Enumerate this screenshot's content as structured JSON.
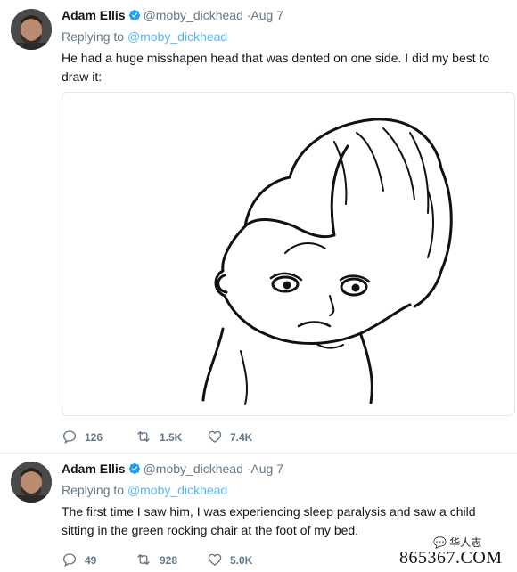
{
  "tweets": [
    {
      "author": {
        "name": "Adam Ellis",
        "handle": "@moby_dickhead",
        "time": "·Aug 7"
      },
      "reply": {
        "prefix": "Replying to",
        "mention": "@moby_dickhead"
      },
      "text": "He had a huge misshapen head that was dented on one side. I did my best to draw it:",
      "stats": {
        "replies": "126",
        "retweets": "1.5K",
        "likes": "7.4K"
      }
    },
    {
      "author": {
        "name": "Adam Ellis",
        "handle": "@moby_dickhead",
        "time": "·Aug 7"
      },
      "reply": {
        "prefix": "Replying to",
        "mention": "@moby_dickhead"
      },
      "text": "The first time I saw him, I was experiencing sleep paralysis and saw a child sitting in the green rocking chair at the foot of my bed.",
      "stats": {
        "replies": "49",
        "retweets": "928",
        "likes": "5.0K"
      }
    }
  ],
  "watermark": {
    "site": "865367.COM",
    "logo_text": "华人志"
  },
  "icons": {
    "reply": "reply-icon",
    "retweet": "retweet-icon",
    "like": "like-icon",
    "verified": "verified-badge-icon"
  },
  "colors": {
    "verified": "#1da1f2",
    "text": "#14171a",
    "muted": "#657786",
    "link": "#1da1f2"
  }
}
